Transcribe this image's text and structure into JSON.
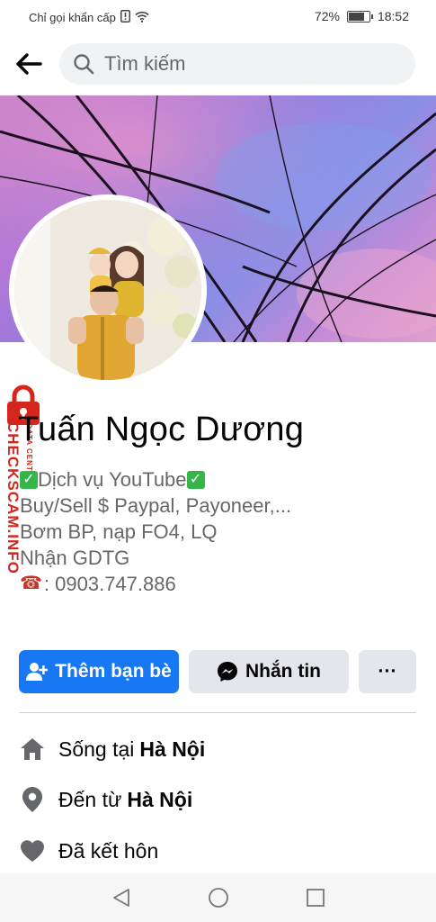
{
  "status_bar": {
    "carrier_text": "Chỉ gọi khẩn cấp",
    "battery_percent": "72%",
    "battery_level": 0.72,
    "time": "18:52"
  },
  "search": {
    "placeholder": "Tìm kiếm"
  },
  "profile": {
    "name": "Tuấn Ngọc Dương",
    "bio": {
      "line1": "Dịch vụ YouTube",
      "line2": "Buy/Sell $ Paypal, Payoneer,...",
      "line3": "Bơm BP, nạp FO4, LQ",
      "line4": "Nhận GDTG",
      "line5": ": 0903.747.886"
    }
  },
  "watermark": {
    "brand": "CHECKSCAM.INFO",
    "sub": "DATA CENTER"
  },
  "actions": {
    "add_friend": "Thêm bạn bè",
    "message": "Nhắn tin",
    "more": "···"
  },
  "info": {
    "lives_prefix": "Sống tại",
    "lives_city": "Hà Nội",
    "from_prefix": "Đến từ",
    "from_city": "Hà Nội",
    "relationship": "Đã kết hôn"
  },
  "colors": {
    "primary": "#1877f2",
    "secondary_btn": "#e4e6eb",
    "icon_gray": "#65676b",
    "watermark": "#d4261c"
  },
  "icons": [
    "back-arrow-icon",
    "search-icon",
    "add-friend-icon",
    "messenger-icon",
    "home-icon",
    "location-icon",
    "heart-icon",
    "nav-back-icon",
    "nav-home-icon",
    "nav-recents-icon"
  ]
}
